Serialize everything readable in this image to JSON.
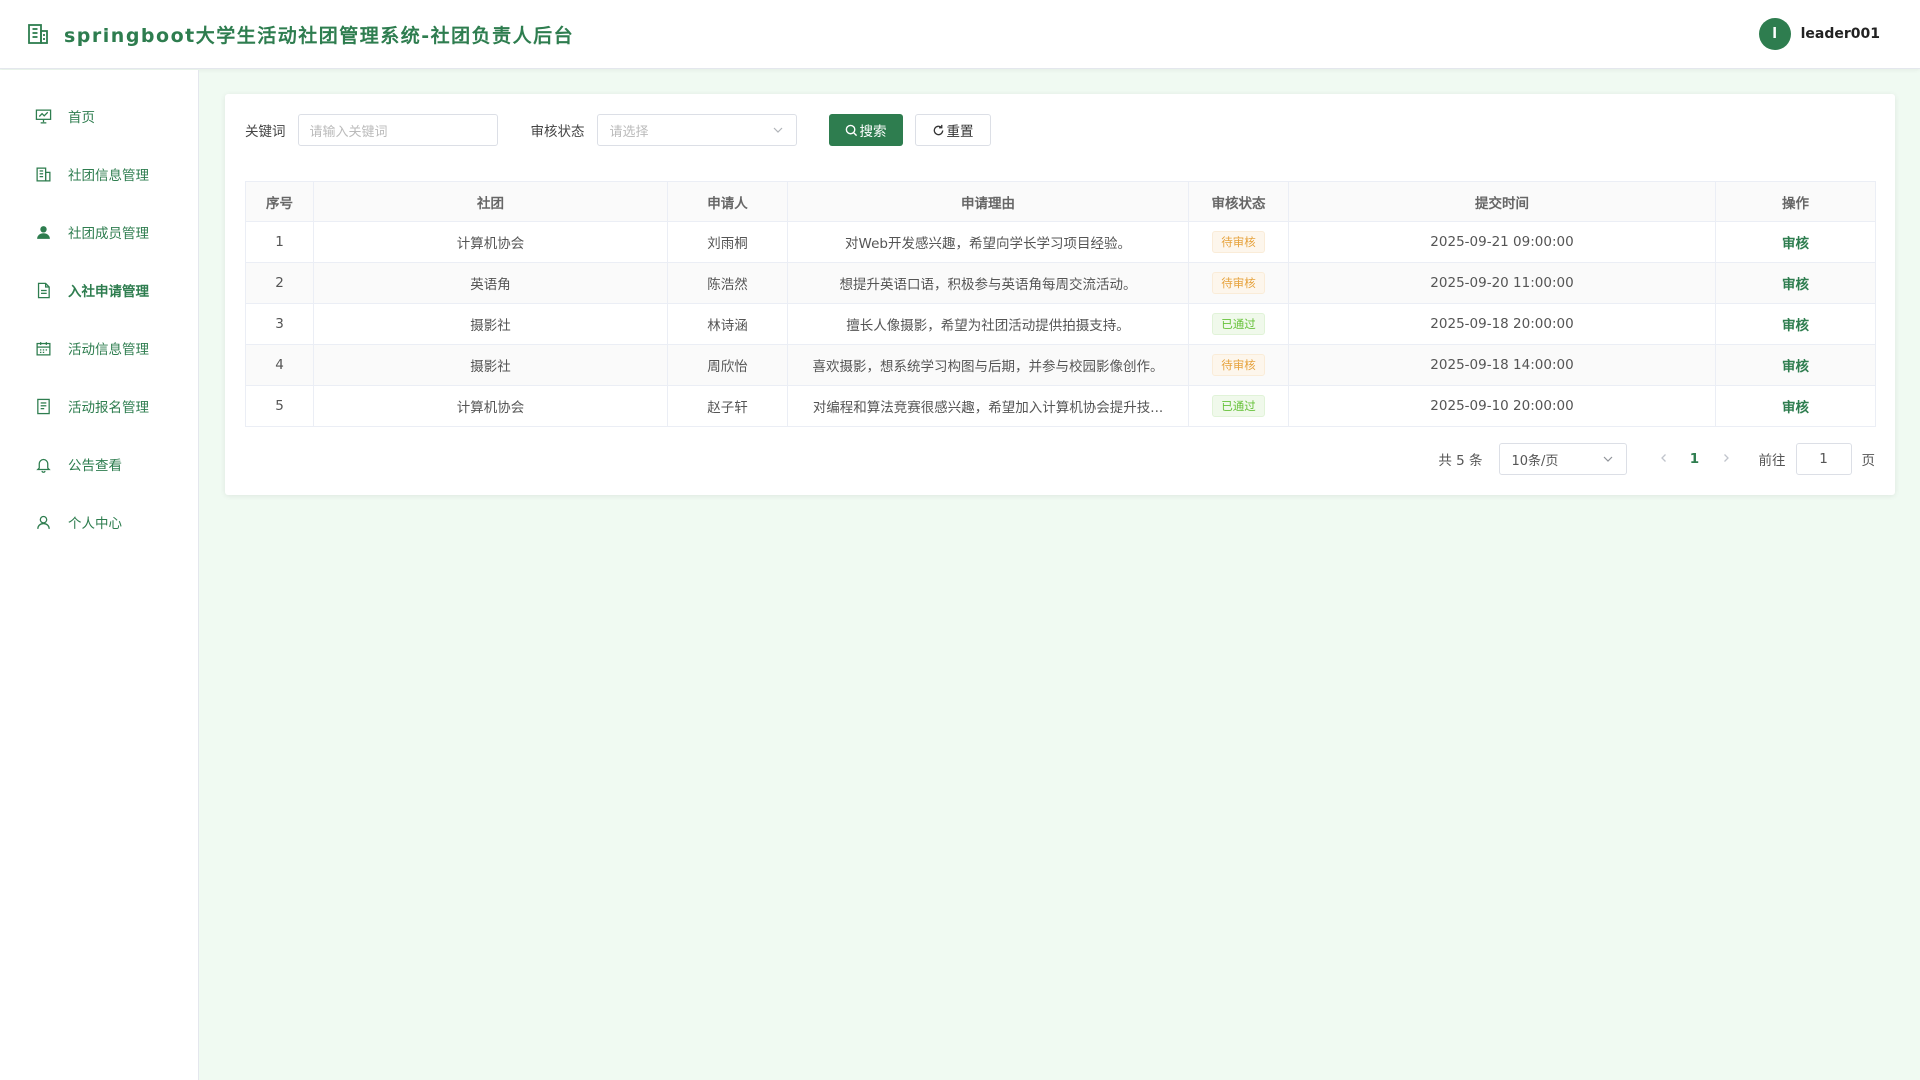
{
  "header": {
    "title": "springboot大学生活动社团管理系统-社团负责人后台",
    "avatar_initial": "l",
    "username": "leader001"
  },
  "sidebar": {
    "items": [
      {
        "label": "首页",
        "icon": "dashboard-icon"
      },
      {
        "label": "社团信息管理",
        "icon": "building-icon"
      },
      {
        "label": "社团成员管理",
        "icon": "user-filled-icon"
      },
      {
        "label": "入社申请管理",
        "icon": "document-icon",
        "active": true
      },
      {
        "label": "活动信息管理",
        "icon": "calendar-icon"
      },
      {
        "label": "活动报名管理",
        "icon": "tickets-icon"
      },
      {
        "label": "公告查看",
        "icon": "bell-icon"
      },
      {
        "label": "个人中心",
        "icon": "user-icon"
      }
    ]
  },
  "filters": {
    "keyword_label": "关键词",
    "keyword_placeholder": "请输入关键词",
    "status_label": "审核状态",
    "status_placeholder": "请选择",
    "search_label": "搜索",
    "reset_label": "重置"
  },
  "table": {
    "headers": [
      "序号",
      "社团",
      "申请人",
      "申请理由",
      "审核状态",
      "提交时间",
      "操作"
    ],
    "rows": [
      {
        "index": "1",
        "club": "计算机协会",
        "applicant": "刘雨桐",
        "reason": "对Web开发感兴趣，希望向学长学习项目经验。",
        "status": "待审核",
        "status_type": "pending",
        "time": "2025-09-21 09:00:00",
        "action": "审核"
      },
      {
        "index": "2",
        "club": "英语角",
        "applicant": "陈浩然",
        "reason": "想提升英语口语，积极参与英语角每周交流活动。",
        "status": "待审核",
        "status_type": "pending",
        "time": "2025-09-20 11:00:00",
        "action": "审核"
      },
      {
        "index": "3",
        "club": "摄影社",
        "applicant": "林诗涵",
        "reason": "擅长人像摄影，希望为社团活动提供拍摄支持。",
        "status": "已通过",
        "status_type": "approved",
        "time": "2025-09-18 20:00:00",
        "action": "审核"
      },
      {
        "index": "4",
        "club": "摄影社",
        "applicant": "周欣怡",
        "reason": "喜欢摄影，想系统学习构图与后期，并参与校园影像创作。",
        "status": "待审核",
        "status_type": "pending",
        "time": "2025-09-18 14:00:00",
        "action": "审核"
      },
      {
        "index": "5",
        "club": "计算机协会",
        "applicant": "赵子轩",
        "reason": "对编程和算法竞赛很感兴趣，希望加入计算机协会提升技...",
        "status": "已通过",
        "status_type": "approved",
        "time": "2025-09-10 20:00:00",
        "action": "审核"
      }
    ]
  },
  "pagination": {
    "total": "共 5 条",
    "page_size": "10条/页",
    "current_page": "1",
    "goto_label": "前往",
    "goto_value": "1",
    "page_suffix": "页"
  },
  "colors": {
    "primary": "#2e7d4f",
    "background": "#f0faf2",
    "pending": "#e6a23c",
    "approved": "#67c23a"
  }
}
